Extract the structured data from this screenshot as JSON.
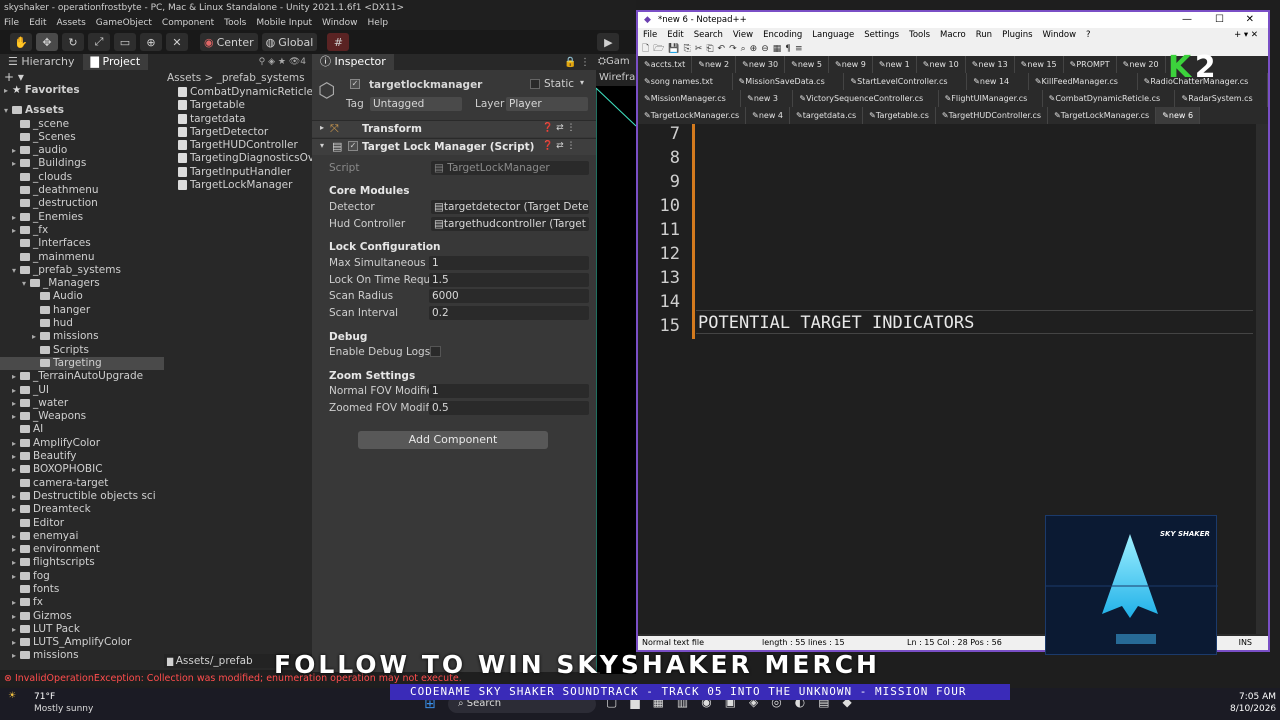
{
  "unity": {
    "title": "skyshaker - operationfrostbyte - PC, Mac & Linux Standalone - Unity 2021.1.6f1 <DX11>",
    "menu": [
      "File",
      "Edit",
      "Assets",
      "GameObject",
      "Component",
      "Tools",
      "Mobile Input",
      "Window",
      "Help"
    ],
    "toolbar": {
      "pivot_label": "Center",
      "space_label": "Global"
    },
    "tabs": {
      "hierarchy": "Hierarchy",
      "project": "Project",
      "inspector": "Inspector",
      "game": "Gam",
      "wireframe": "Wirefra"
    },
    "search_count": "4",
    "favorites": "Favorites",
    "assets_root": "Assets",
    "tree": [
      {
        "label": "_scene",
        "indent": 2,
        "arrow": ""
      },
      {
        "label": "_Scenes",
        "indent": 2,
        "arrow": ""
      },
      {
        "label": "_audio",
        "indent": 2,
        "arrow": "▸"
      },
      {
        "label": "_Buildings",
        "indent": 2,
        "arrow": "▸"
      },
      {
        "label": "_clouds",
        "indent": 2,
        "arrow": ""
      },
      {
        "label": "_deathmenu",
        "indent": 2,
        "arrow": ""
      },
      {
        "label": "_destruction",
        "indent": 2,
        "arrow": ""
      },
      {
        "label": "_Enemies",
        "indent": 2,
        "arrow": "▸"
      },
      {
        "label": "_fx",
        "indent": 2,
        "arrow": "▸"
      },
      {
        "label": "_Interfaces",
        "indent": 2,
        "arrow": ""
      },
      {
        "label": "_mainmenu",
        "indent": 2,
        "arrow": ""
      },
      {
        "label": "_prefab_systems",
        "indent": 2,
        "arrow": "▾"
      },
      {
        "label": "_Managers",
        "indent": 3,
        "arrow": "▾"
      },
      {
        "label": "Audio",
        "indent": 4,
        "arrow": ""
      },
      {
        "label": "hanger",
        "indent": 4,
        "arrow": ""
      },
      {
        "label": "hud",
        "indent": 4,
        "arrow": ""
      },
      {
        "label": "missions",
        "indent": 4,
        "arrow": "▸"
      },
      {
        "label": "Scripts",
        "indent": 4,
        "arrow": ""
      },
      {
        "label": "Targeting",
        "indent": 4,
        "arrow": "",
        "selected": true
      },
      {
        "label": "_TerrainAutoUpgrade",
        "indent": 2,
        "arrow": "▸"
      },
      {
        "label": "_UI",
        "indent": 2,
        "arrow": "▸"
      },
      {
        "label": "_water",
        "indent": 2,
        "arrow": "▸"
      },
      {
        "label": "_Weapons",
        "indent": 2,
        "arrow": "▸"
      },
      {
        "label": "AI",
        "indent": 2,
        "arrow": ""
      },
      {
        "label": "AmplifyColor",
        "indent": 2,
        "arrow": "▸"
      },
      {
        "label": "Beautify",
        "indent": 2,
        "arrow": "▸"
      },
      {
        "label": "BOXOPHOBIC",
        "indent": 2,
        "arrow": "▸"
      },
      {
        "label": "camera-target",
        "indent": 2,
        "arrow": ""
      },
      {
        "label": "Destructible objects sci",
        "indent": 2,
        "arrow": "▸"
      },
      {
        "label": "Dreamteck",
        "indent": 2,
        "arrow": "▸"
      },
      {
        "label": "Editor",
        "indent": 2,
        "arrow": ""
      },
      {
        "label": "enemyai",
        "indent": 2,
        "arrow": "▸"
      },
      {
        "label": "environment",
        "indent": 2,
        "arrow": "▸"
      },
      {
        "label": "flightscripts",
        "indent": 2,
        "arrow": "▸"
      },
      {
        "label": "fog",
        "indent": 2,
        "arrow": "▸"
      },
      {
        "label": "fonts",
        "indent": 2,
        "arrow": ""
      },
      {
        "label": "fx",
        "indent": 2,
        "arrow": "▸"
      },
      {
        "label": "Gizmos",
        "indent": 2,
        "arrow": "▸"
      },
      {
        "label": "LUT Pack",
        "indent": 2,
        "arrow": "▸"
      },
      {
        "label": "LUTS_AmplifyColor",
        "indent": 2,
        "arrow": "▸"
      },
      {
        "label": "missions",
        "indent": 2,
        "arrow": "▸"
      }
    ],
    "breadcrumb": "Assets > _prefab_systems",
    "files": [
      "CombatDynamicReticle",
      "Targetable",
      "targetdata",
      "TargetDetector",
      "TargetHUDController",
      "TargetingDiagnosticsOve",
      "TargetInputHandler",
      "TargetLockManager"
    ],
    "bottom_path": "Assets/_prefab",
    "inspector": {
      "object_name": "targetlockmanager",
      "static_label": "Static",
      "tag_label": "Tag",
      "tag_value": "Untagged",
      "layer_label": "Layer",
      "layer_value": "Player",
      "transform": "Transform",
      "script_component": "Target Lock Manager (Script)",
      "script_label": "Script",
      "script_value": "TargetLockManager",
      "core_modules": "Core Modules",
      "detector_label": "Detector",
      "detector_value": "targetdetector (Target Dete",
      "hud_label": "Hud Controller",
      "hud_value": "targethudcontroller (Target",
      "lock_config": "Lock Configuration",
      "max_label": "Max Simultaneous Lo",
      "max_value": "1",
      "time_label": "Lock On Time Requir",
      "time_value": "1.5",
      "radius_label": "Scan Radius",
      "radius_value": "6000",
      "interval_label": "Scan Interval",
      "interval_value": "0.2",
      "debug": "Debug",
      "debug_logs_label": "Enable Debug Logs",
      "zoom": "Zoom Settings",
      "normal_fov_label": "Normal FOV Modifier",
      "normal_fov_value": "1",
      "zoomed_fov_label": "Zoomed FOV Modifie",
      "zoomed_fov_value": "0.5",
      "add_component": "Add Component"
    },
    "error": "InvalidOperationException: Collection was modified; enumeration operation may not execute."
  },
  "notepad": {
    "title": "*new 6 - Notepad++",
    "menu": [
      "File",
      "Edit",
      "Search",
      "View",
      "Encoding",
      "Language",
      "Settings",
      "Tools",
      "Macro",
      "Run",
      "Plugins",
      "Window",
      "?"
    ],
    "tabs_row1": [
      "accts.txt",
      "new 2",
      "new 30",
      "new 5",
      "new 9",
      "new 1",
      "new 10",
      "new 13",
      "new 15",
      "PROMPT",
      "new 20"
    ],
    "tabs_row2": [
      "song names.txt",
      "MissionSaveData.cs",
      "StartLevelController.cs",
      "new 14",
      "KillFeedManager.cs",
      "RadioChatterManager.cs"
    ],
    "tabs_row3": [
      "MissionManager.cs",
      "new 3",
      "VictorySequenceController.cs",
      "FlightUIManager.cs",
      "CombatDynamicReticle.cs",
      "RadarSystem.cs"
    ],
    "tabs_row4": [
      "TargetLockManager.cs",
      "new 4",
      "targetdata.cs",
      "Targetable.cs",
      "TargetHUDController.cs",
      "TargetLockManager.cs",
      "new 6"
    ],
    "line_numbers": [
      "7",
      "8",
      "9",
      "10",
      "11",
      "12",
      "13",
      "14",
      "15"
    ],
    "line15_text": "POTENTIAL TARGET INDICATORS",
    "status_type": "Normal text file",
    "status_length": "length : 55   lines : 15",
    "status_pos": "Ln : 15   Col : 28   Pos : 56",
    "status_ins": "INS"
  },
  "overlay": {
    "follow_banner": "FOLLOW TO WIN SKYSHAKER MERCH",
    "soundtrack": "CODENAME SKY SHAKER SOUNDTRACK - TRACK 05 INTO THE UNKNOWN  - MISSION FOUR",
    "logo_text": "SKY SHAKER",
    "k2_text": "2"
  },
  "taskbar": {
    "weather_temp": "71°F",
    "weather_desc": "Mostly sunny",
    "search_label": "Search",
    "time": "7:05 AM",
    "date": "8/10/2026"
  }
}
